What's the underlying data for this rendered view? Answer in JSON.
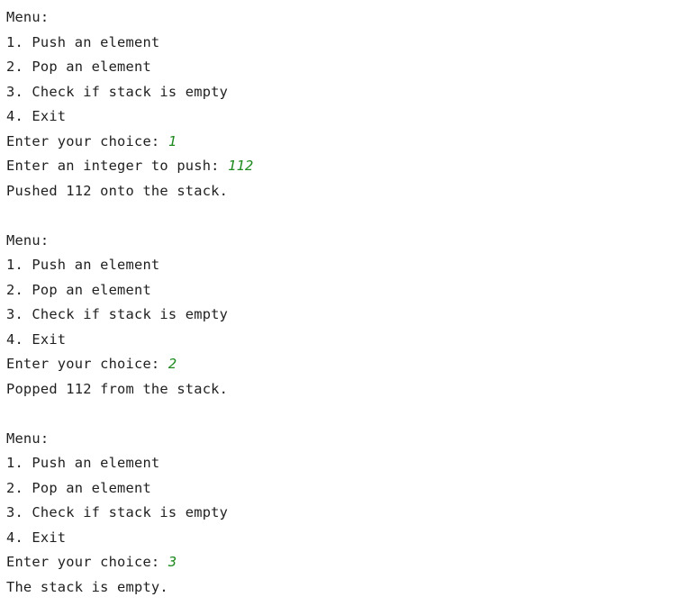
{
  "console": {
    "sessions": [
      {
        "menu_title": "Menu:",
        "options": [
          "1. Push an element",
          "2. Pop an element",
          "3. Check if stack is empty",
          "4. Exit"
        ],
        "choice_prompt": "Enter your choice: ",
        "choice_input": "1",
        "push_prompt": "Enter an integer to push: ",
        "push_input": "112",
        "result": "Pushed 112 onto the stack."
      },
      {
        "menu_title": "Menu:",
        "options": [
          "1. Push an element",
          "2. Pop an element",
          "3. Check if stack is empty",
          "4. Exit"
        ],
        "choice_prompt": "Enter your choice: ",
        "choice_input": "2",
        "result": "Popped 112 from the stack."
      },
      {
        "menu_title": "Menu:",
        "options": [
          "1. Push an element",
          "2. Pop an element",
          "3. Check if stack is empty",
          "4. Exit"
        ],
        "choice_prompt": "Enter your choice: ",
        "choice_input": "3",
        "result": "The stack is empty."
      }
    ]
  },
  "colors": {
    "text": "#1f1f1f",
    "user_input": "#1f8a1f",
    "background": "#ffffff"
  }
}
